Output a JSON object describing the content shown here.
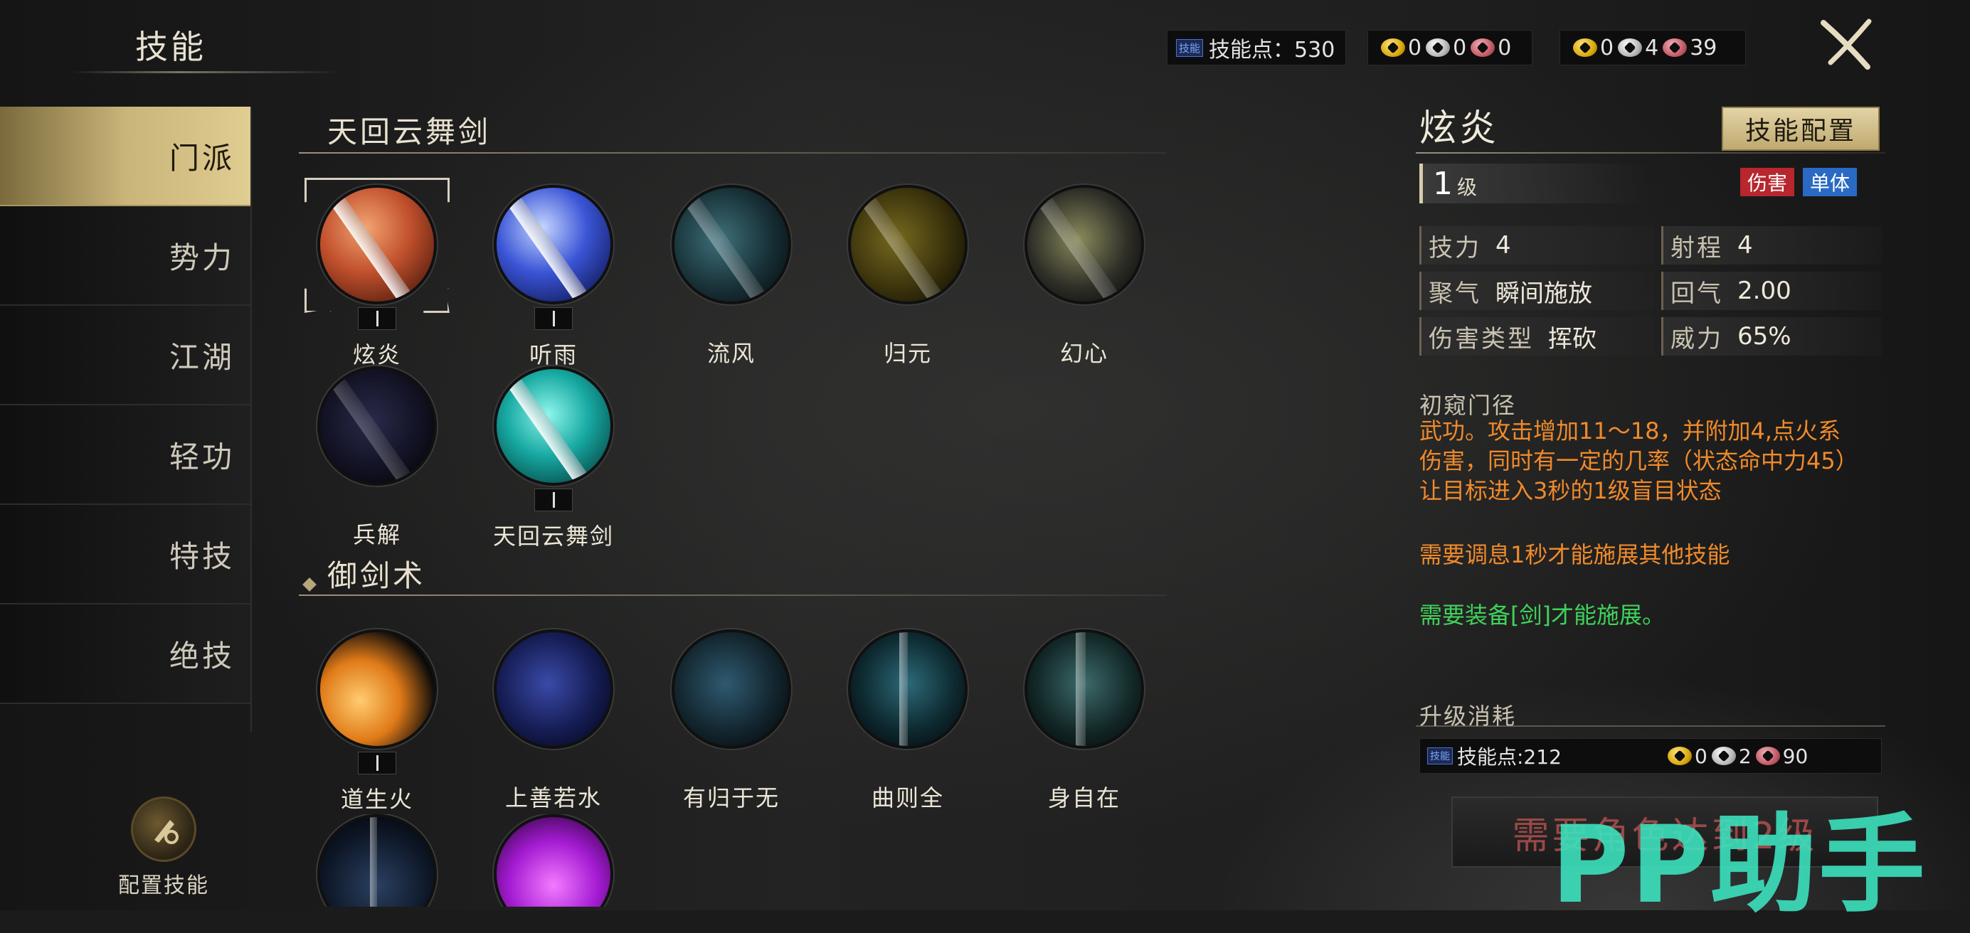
{
  "header": {
    "title": "技能",
    "skill_points_tag": "技能",
    "skill_points_label": "技能点：530",
    "coins_set1": {
      "gold": "0",
      "silver": "0",
      "copper": "0"
    },
    "coins_set2": {
      "gold": "0",
      "silver": "4",
      "copper": "39"
    }
  },
  "nav": {
    "items": [
      "门派",
      "势力",
      "江湖",
      "轻功",
      "特技",
      "绝技"
    ],
    "active_index": 0,
    "config_label": "配置技能"
  },
  "sections": [
    {
      "title": "天回云舞剑",
      "skills": [
        {
          "name": "炫炎",
          "icon": "fire-sword-icon",
          "selected": true
        },
        {
          "name": "听雨",
          "icon": "rain-sword-icon"
        },
        {
          "name": "流风",
          "icon": "wind-sword-icon"
        },
        {
          "name": "归元",
          "icon": "return-sword-icon"
        },
        {
          "name": "幻心",
          "icon": "illusion-heart-icon"
        },
        {
          "name": "兵解",
          "icon": "weapon-release-icon"
        },
        {
          "name": "天回云舞剑",
          "icon": "cloud-dance-sword-icon"
        }
      ]
    },
    {
      "title": "御剑术",
      "skills": [
        {
          "name": "道生火",
          "icon": "dao-fire-icon"
        },
        {
          "name": "上善若水",
          "icon": "water-icon"
        },
        {
          "name": "有归于无",
          "icon": "void-icon"
        },
        {
          "name": "曲则全",
          "icon": "curve-icon"
        },
        {
          "name": "身自在",
          "icon": "free-body-icon"
        }
      ]
    }
  ],
  "detail": {
    "name": "炫炎",
    "config_button": "技能配置",
    "level_num": "1",
    "level_unit": "级",
    "badge_damage": "伤害",
    "badge_single": "单体",
    "stats": {
      "skill_power_key": "技力",
      "skill_power_val": "4",
      "range_key": "射程",
      "range_val": "4",
      "charge_key": "聚气",
      "charge_val": "瞬间施放",
      "regen_key": "回气",
      "regen_val": "2.00",
      "dmg_type_key": "伤害类型",
      "dmg_type_val": "挥砍",
      "power_key": "威力",
      "power_val": "65%"
    },
    "desc_head": "初窥门径",
    "desc_body": "武功。攻击增加11～18，并附加4,点火系伤害，同时有一定的几率（状态命中力45）让目标进入3秒的1级盲目状态",
    "desc_cool": "需要调息1秒才能施展其他技能",
    "desc_need": "需要装备[剑]才能施展。",
    "upgrade_head": "升级消耗",
    "upgrade_tag": "技能",
    "upgrade_points": "技能点:212",
    "upgrade_coins": {
      "gold": "0",
      "silver": "2",
      "copper": "90"
    },
    "upgrade_button": "需要角色达到2级"
  },
  "watermark": "PP助手"
}
